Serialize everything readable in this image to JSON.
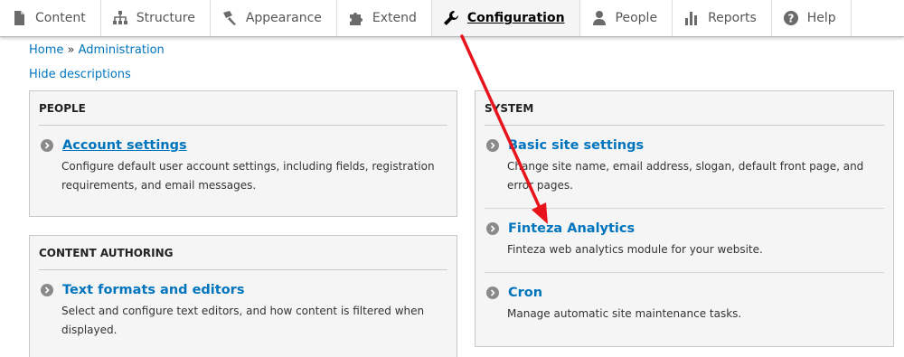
{
  "toolbar": {
    "tabs": [
      {
        "label": "Content",
        "icon": "file-icon"
      },
      {
        "label": "Structure",
        "icon": "sitemap-icon"
      },
      {
        "label": "Appearance",
        "icon": "paint-brush-icon"
      },
      {
        "label": "Extend",
        "icon": "puzzle-icon"
      },
      {
        "label": "Configuration",
        "icon": "wrench-icon",
        "active": true
      },
      {
        "label": "People",
        "icon": "person-icon"
      },
      {
        "label": "Reports",
        "icon": "bar-chart-icon"
      },
      {
        "label": "Help",
        "icon": "question-icon"
      }
    ]
  },
  "breadcrumb": {
    "home": "Home",
    "separator": "»",
    "current": "Administration"
  },
  "hide_descriptions": "Hide descriptions",
  "panels": {
    "people": {
      "title": "People",
      "items": [
        {
          "label": "Account settings",
          "description": "Configure default user account settings, including fields, registration requirements, and email messages."
        }
      ]
    },
    "content_authoring": {
      "title": "Content authoring",
      "items": [
        {
          "label": "Text formats and editors",
          "description": "Select and configure text editors, and how content is filtered when displayed."
        }
      ]
    },
    "system": {
      "title": "System",
      "items": [
        {
          "label": "Basic site settings",
          "description": "Change site name, email address, slogan, default front page, and error pages."
        },
        {
          "label": "Finteza Analytics",
          "description": "Finteza web analytics module for your website."
        },
        {
          "label": "Cron",
          "description": "Manage automatic site maintenance tasks."
        }
      ]
    }
  },
  "colors": {
    "link": "#0074bd",
    "annotation_arrow": "#e8141b",
    "panel_bg": "#f5f5f5"
  }
}
